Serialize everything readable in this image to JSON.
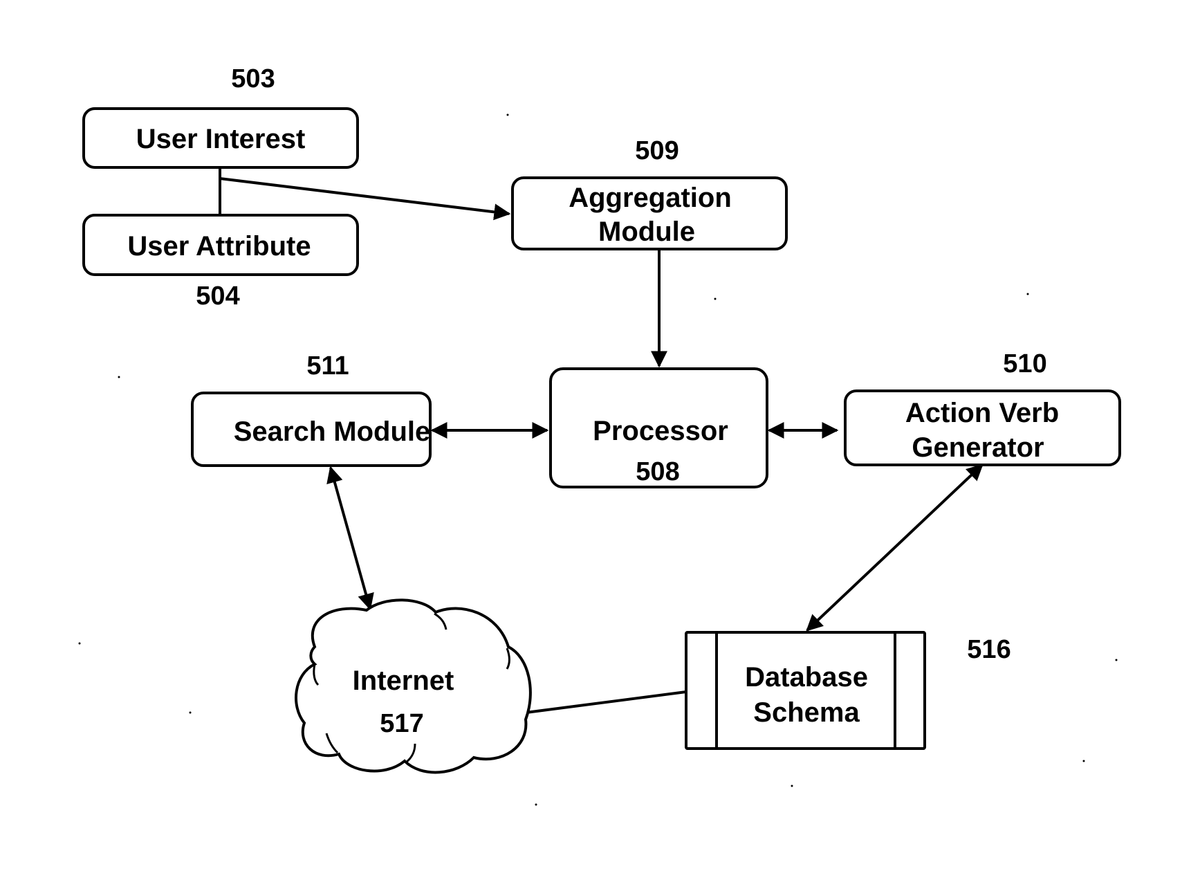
{
  "diagram": {
    "nodes": {
      "user_interest": {
        "label": [
          "User Interest"
        ],
        "ref": "503",
        "shape": "rounded-rect"
      },
      "user_attribute": {
        "label": [
          "User Attribute"
        ],
        "ref": "504",
        "shape": "rounded-rect"
      },
      "aggregation_module": {
        "label": [
          "Aggregation",
          "Module"
        ],
        "ref": "509",
        "shape": "rounded-rect"
      },
      "search_module": {
        "label": [
          "Search Module"
        ],
        "ref": "511",
        "shape": "rounded-rect"
      },
      "processor": {
        "label": [
          "Processor"
        ],
        "ref": "508",
        "shape": "rounded-rect"
      },
      "action_verb_generator": {
        "label": [
          "Action Verb",
          "Generator"
        ],
        "ref": "510",
        "shape": "rounded-rect"
      },
      "internet": {
        "label": [
          "Internet"
        ],
        "ref": "517",
        "shape": "cloud"
      },
      "database_schema": {
        "label": [
          "Database",
          "Schema"
        ],
        "ref": "516",
        "shape": "database"
      }
    },
    "edges": [
      {
        "from": "user_interest",
        "to": "user_attribute",
        "type": "line"
      },
      {
        "from": "user_interest",
        "to": "aggregation_module",
        "type": "arrow"
      },
      {
        "from": "aggregation_module",
        "to": "processor",
        "type": "arrow"
      },
      {
        "from": "search_module",
        "to": "processor",
        "type": "bidirectional"
      },
      {
        "from": "processor",
        "to": "action_verb_generator",
        "type": "bidirectional"
      },
      {
        "from": "search_module",
        "to": "internet",
        "type": "bidirectional"
      },
      {
        "from": "action_verb_generator",
        "to": "database_schema",
        "type": "bidirectional"
      },
      {
        "from": "internet",
        "to": "database_schema",
        "type": "line"
      }
    ]
  }
}
